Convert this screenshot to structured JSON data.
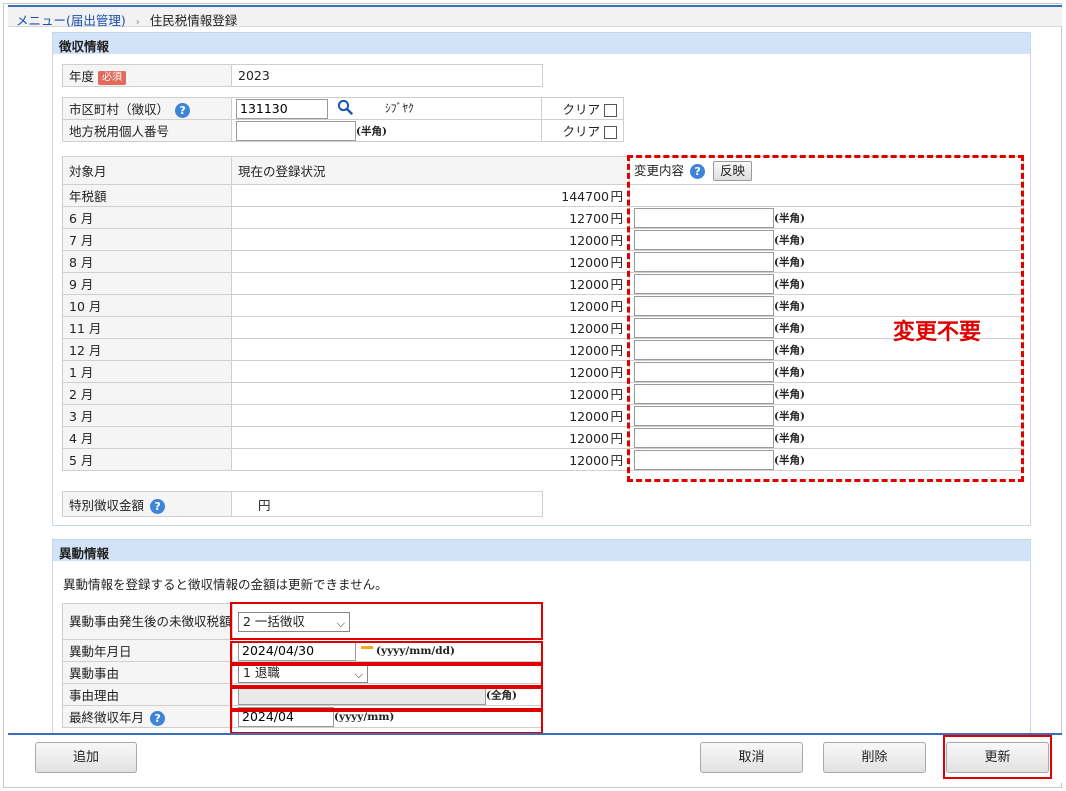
{
  "breadcrumb": {
    "menu_link": "メニュー(届出管理)",
    "separator": "›",
    "current": "住民税情報登録"
  },
  "choshu": {
    "title": "徴収情報",
    "year": {
      "label": "年度",
      "required": "必須",
      "value": "2023"
    },
    "municipality": {
      "label": "市区町村（徴収）",
      "code": "131130",
      "kana": "ｼﾌﾞﾔｸ",
      "clear": "クリア"
    },
    "personal_no": {
      "label": "地方税用個人番号",
      "value": "",
      "hint": "(半角)",
      "clear": "クリア"
    },
    "table": {
      "col_month": "対象月",
      "col_status": "現在の登録状況",
      "col_change": "変更内容",
      "reflect_button": "反映",
      "annual_label": "年税額",
      "annual_value": "144700",
      "yen": "円",
      "hint": "(半角)",
      "rows": [
        {
          "month": "6 月",
          "value": "12700"
        },
        {
          "month": "7 月",
          "value": "12000"
        },
        {
          "month": "8 月",
          "value": "12000"
        },
        {
          "month": "9 月",
          "value": "12000"
        },
        {
          "month": "10 月",
          "value": "12000"
        },
        {
          "month": "11 月",
          "value": "12000"
        },
        {
          "month": "12 月",
          "value": "12000"
        },
        {
          "month": "1 月",
          "value": "12000"
        },
        {
          "month": "2 月",
          "value": "12000"
        },
        {
          "month": "3 月",
          "value": "12000"
        },
        {
          "month": "4 月",
          "value": "12000"
        },
        {
          "month": "5 月",
          "value": "12000"
        }
      ]
    },
    "special": {
      "label": "特別徴収金額",
      "yen": "円"
    },
    "annotation": "変更不要"
  },
  "ido": {
    "title": "異動情報",
    "note": "異動情報を登録すると徴収情報の金額は更新できません。",
    "method": {
      "label": "異動事由発生後の未徴収税額の徴収方法",
      "value": "2 一括徴収"
    },
    "date": {
      "label": "異動年月日",
      "value": "2024/04/30",
      "hint": "(yyyy/mm/dd)"
    },
    "reason": {
      "label": "異動事由",
      "value": "1 退職"
    },
    "reason_detail": {
      "label": "事由理由",
      "value": "",
      "hint": "(全角)"
    },
    "last_month": {
      "label": "最終徴収年月",
      "value": "2024/04",
      "hint": "(yyyy/mm)"
    }
  },
  "buttons": {
    "add": "追加",
    "cancel": "取消",
    "delete": "削除",
    "update": "更新"
  },
  "colors": {
    "accent": "#3a6fb8",
    "panel_header": "#d3e3f7",
    "highlight": "#e00000",
    "help_icon": "#3d85d8"
  },
  "icons": {
    "search": "search-icon",
    "help": "help-icon",
    "calendar": "calendar-icon",
    "dropdown": "chevron-down-icon"
  }
}
